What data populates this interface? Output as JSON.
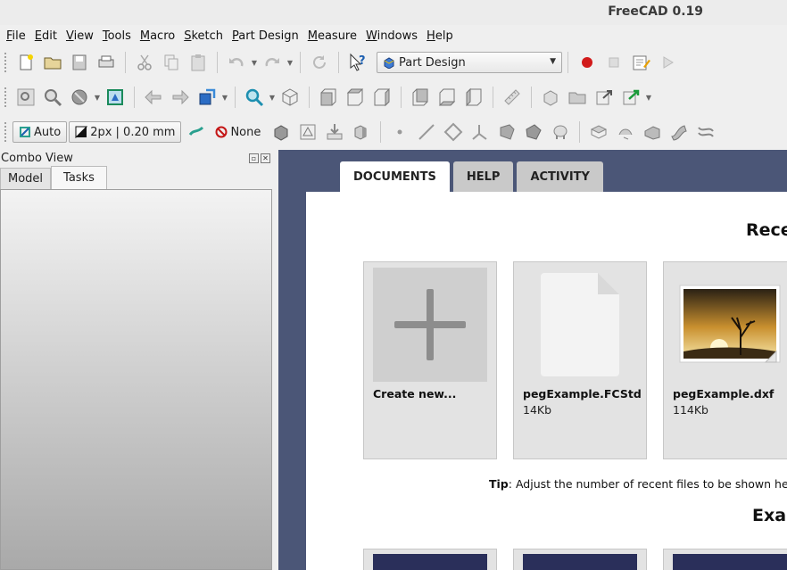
{
  "window": {
    "title": "FreeCAD 0.19"
  },
  "menubar": {
    "items": [
      {
        "u": "F",
        "rest": "ile"
      },
      {
        "u": "E",
        "rest": "dit"
      },
      {
        "u": "V",
        "rest": "iew"
      },
      {
        "u": "T",
        "rest": "ools"
      },
      {
        "u": "M",
        "rest": "acro"
      },
      {
        "u": "S",
        "rest": "ketch"
      },
      {
        "u": "P",
        "rest": "art Design"
      },
      {
        "u": "M",
        "rest": "easure"
      },
      {
        "u": "W",
        "rest": "indows"
      },
      {
        "u": "H",
        "rest": "elp"
      }
    ]
  },
  "toolbar": {
    "workbench": "Part Design",
    "auto_label": "Auto",
    "line_width": "2px | 0.20 mm",
    "none_label": "None"
  },
  "combo_view": {
    "title": "Combo View",
    "tabs": [
      "Model",
      "Tasks"
    ],
    "active_tab": "Tasks"
  },
  "start_page": {
    "tabs": [
      "DOCUMENTS",
      "HELP",
      "ACTIVITY"
    ],
    "active_tab": "DOCUMENTS",
    "recent_heading": "Recent Files",
    "recent": [
      {
        "name": "Create new...",
        "size": ""
      },
      {
        "name": "pegExample.FCStd",
        "size": "14Kb"
      },
      {
        "name": "pegExample.dxf",
        "size": "114Kb"
      }
    ],
    "tip_label": "Tip",
    "tip_text": ": Adjust the number of recent files to be shown here in menu Edit -> Preferences -> General -> Size of recent file list",
    "examples_heading": "Examples"
  },
  "colors": {
    "view_background": "#4b5677",
    "record_red": "#d11a1a",
    "accent_green": "#2aa08f"
  }
}
